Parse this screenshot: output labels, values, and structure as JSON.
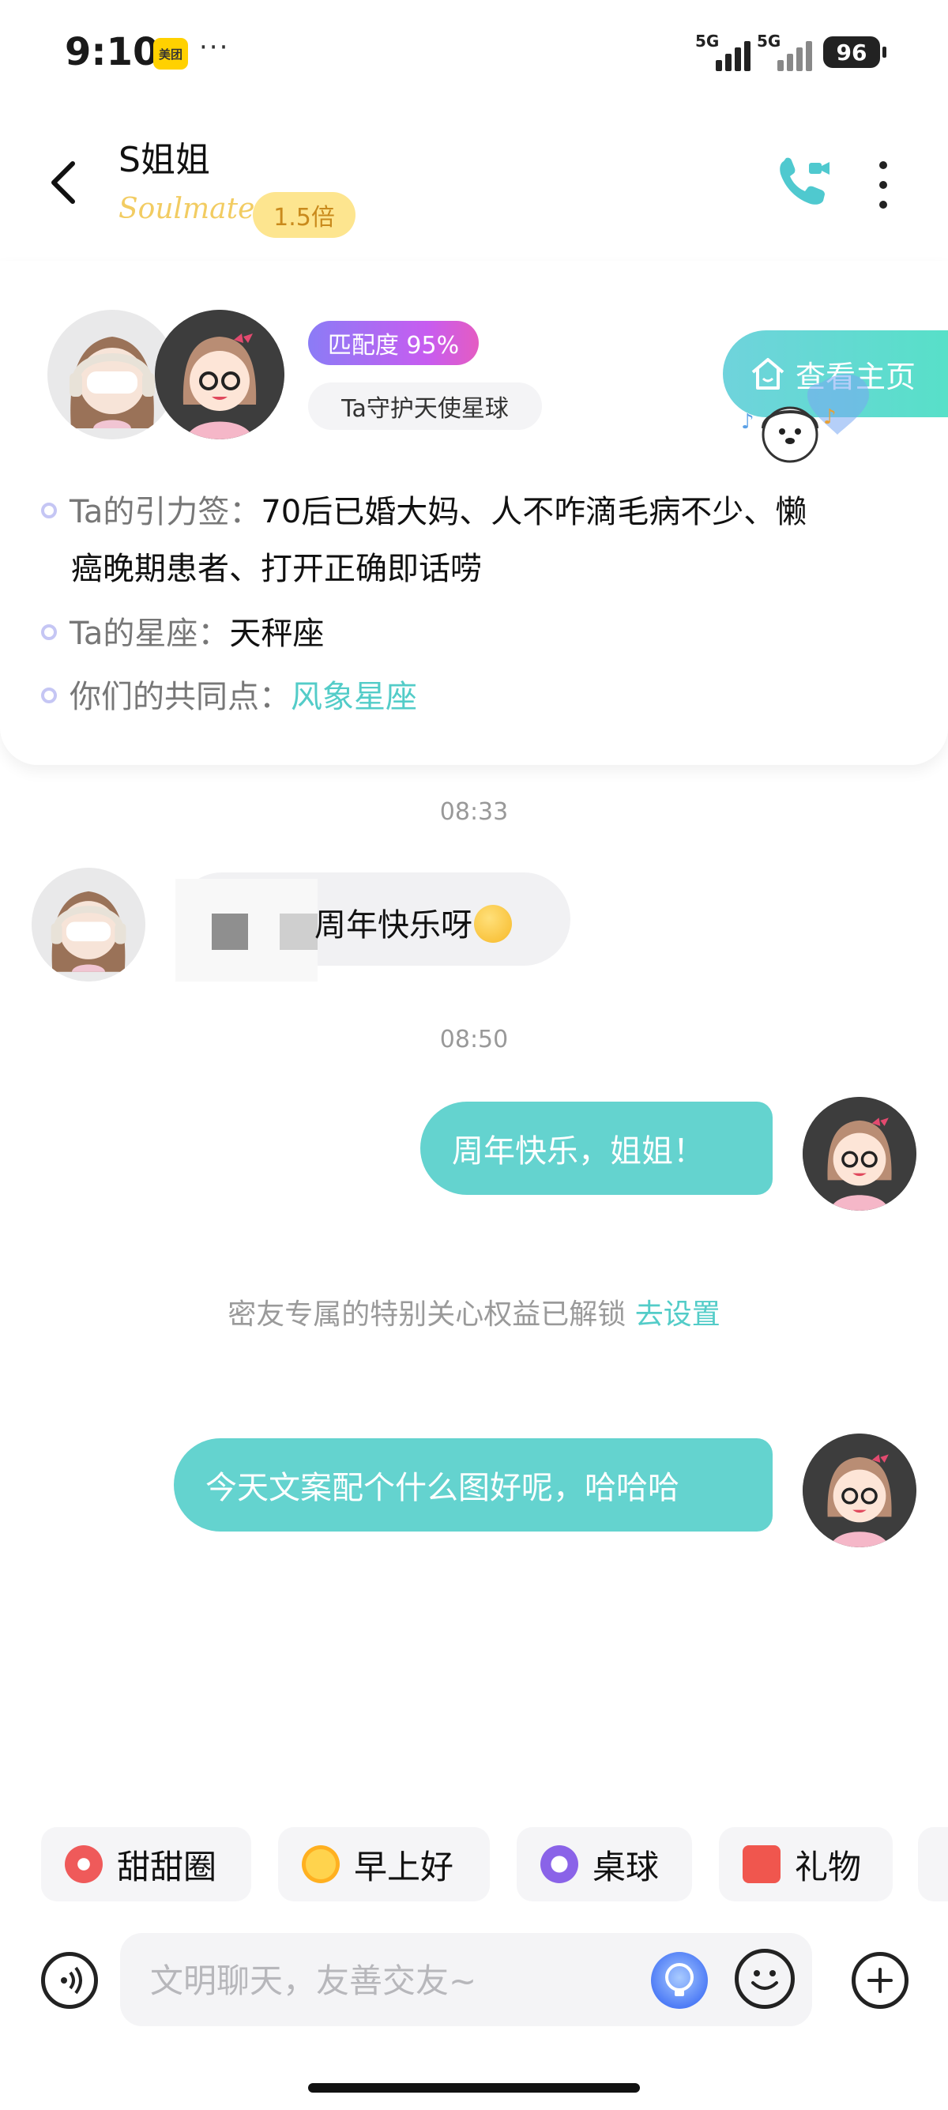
{
  "status_bar": {
    "time": "9:10",
    "app_badge": "美团",
    "overflow": "···",
    "network_1": "5G",
    "network_2": "5G",
    "battery": "96"
  },
  "header": {
    "name": "S姐姐",
    "relationship_tag": "Soulmate",
    "multiplier": "1.5倍"
  },
  "profile": {
    "match_badge": "匹配度 95%",
    "guard_badge": "Ta守护天使星球",
    "homepage_button": "查看主页",
    "tags_label": "Ta的引力签：",
    "tags_value_line1": "70后已婚大妈、人不咋滴毛病不少、懒",
    "tags_value_line2": "癌晚期患者、打开正确即话唠",
    "zodiac_label": "Ta的星座：",
    "zodiac_value": "天秤座",
    "common_label": "你们的共同点：",
    "common_value": "风象星座"
  },
  "messages": {
    "time_1": "08:33",
    "incoming_text": "周年快乐呀",
    "time_2": "08:50",
    "outgoing_1": "周年快乐，姐姐！",
    "system_text": "密友专属的特别关心权益已解锁",
    "system_link": "去设置",
    "outgoing_2": "今天文案配个什么图好呢，哈哈哈"
  },
  "quick_chips": [
    {
      "label": "甜甜圈",
      "icon": "donut-icon"
    },
    {
      "label": "早上好",
      "icon": "sun-icon"
    },
    {
      "label": "桌球",
      "icon": "billiard-ball-icon"
    },
    {
      "label": "礼物",
      "icon": "gift-icon"
    }
  ],
  "input": {
    "placeholder": "文明聊天，友善交友~"
  },
  "colors": {
    "accent": "#53ccc8",
    "outgoing_bubble": "#64d3cf",
    "match_gradient": "#8b7cf6",
    "multiplier_bg": "#fde58f"
  }
}
